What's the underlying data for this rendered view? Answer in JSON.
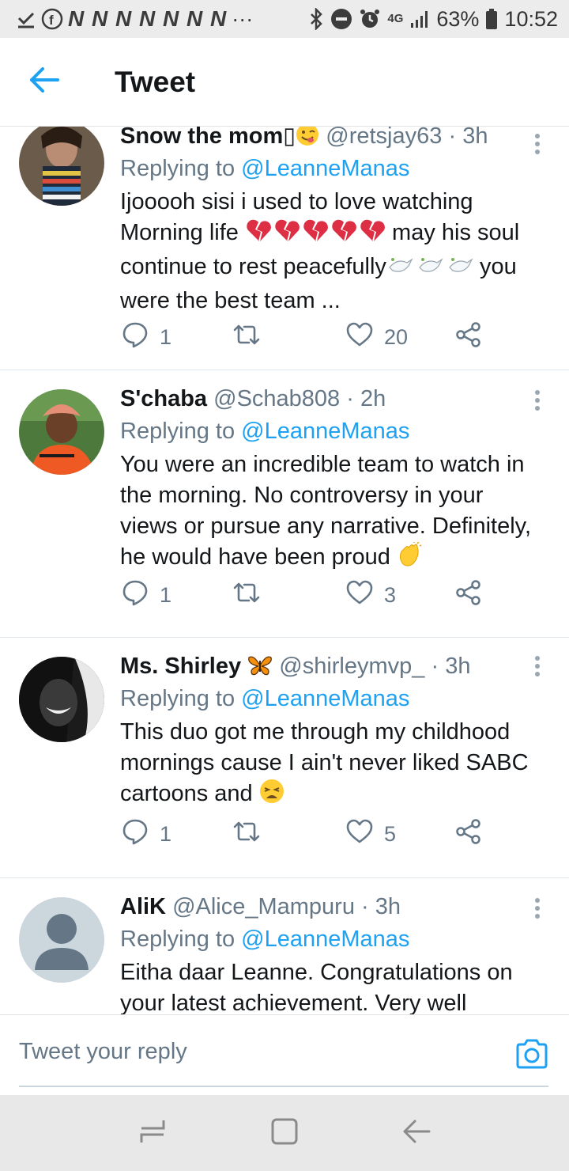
{
  "status_bar": {
    "n_icons": "N N N N N N N",
    "more": "···",
    "network": "4G",
    "battery": "63%",
    "time": "10:52"
  },
  "header": {
    "title": "Tweet"
  },
  "tweets": [
    {
      "name": "Snow the mom",
      "name_glyph": "▯",
      "handle": "@retsjay63",
      "dot": "·",
      "time": "3h",
      "replying_prefix": "Replying to",
      "mention": "@LeanneManas",
      "text_1": "Ijooooh sisi i used to love watching",
      "text_2a": "Morning life",
      "text_2b": "may his soul",
      "text_3a": "continue to rest peacefully",
      "text_3b": "you",
      "text_4": "were the best team ...",
      "replies": "1",
      "likes": "20"
    },
    {
      "name": "S'chaba",
      "handle": "@Schab808",
      "dot": "·",
      "time": "2h",
      "replying_prefix": "Replying to",
      "mention": "@LeanneManas",
      "text_1": "You were an incredible team to watch in",
      "text_2": "the morning. No controversy in your",
      "text_3": "views or pursue any narrative. Definitely,",
      "text_4": "he would have been proud",
      "replies": "1",
      "likes": "3"
    },
    {
      "name": "Ms. Shirley",
      "handle": "@shirleymvp_",
      "dot": "·",
      "time": "3h",
      "replying_prefix": "Replying to",
      "mention": "@LeanneManas",
      "text_1": "This duo got me through my childhood",
      "text_2": "mornings cause I ain't never liked SABC",
      "text_3": "cartoons and",
      "replies": "1",
      "likes": "5"
    },
    {
      "name": "AliK",
      "handle": "@Alice_Mampuru",
      "dot": "·",
      "time": "3h",
      "replying_prefix": "Replying to",
      "mention": "@LeanneManas",
      "text_1": "Eitha daar Leanne. Congratulations on",
      "text_2": "your latest achievement. Very well"
    }
  ],
  "reply_bar": {
    "placeholder": "Tweet your reply"
  },
  "colors": {
    "accent": "#1da1f2",
    "secondary_text": "#657786",
    "primary_text": "#14171a"
  }
}
